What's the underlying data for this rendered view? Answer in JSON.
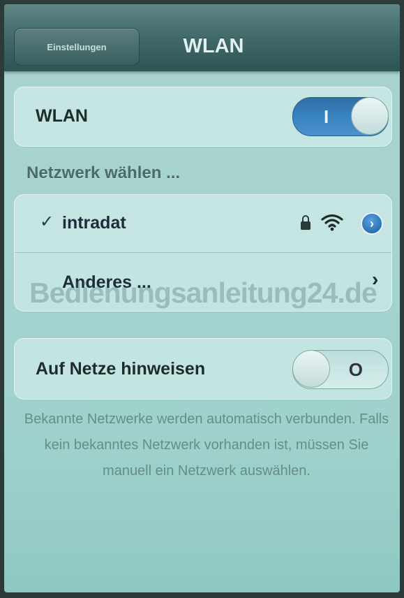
{
  "navbar": {
    "back_label": "Einstellungen",
    "title": "WLAN"
  },
  "wlan_group": {
    "label": "WLAN",
    "toggle_state": "on",
    "toggle_text": "I"
  },
  "networks": {
    "section_header": "Netzwerk wählen ...",
    "items": [
      {
        "check": "✓",
        "name": "intradat",
        "lock_icon": "lock-icon",
        "wifi_icon": "wifi-signal-icon",
        "detail_icon": "info-arrow-icon",
        "detail_glyph": "›"
      }
    ],
    "other": {
      "label": "Anderes ...",
      "chevron": "›"
    }
  },
  "ask_group": {
    "label": "Auf Netze hinweisen",
    "toggle_state": "off",
    "toggle_text": "O"
  },
  "footer": {
    "text": "Bekannte Netzwerke werden automatisch verbunden. Falls kein bekanntes Netzwerk vorhanden ist, müssen Sie manuell ein Netzwerk auswählen."
  },
  "watermark": "Bedienungsanleitung24.de",
  "colors": {
    "background": "#a6d3cf",
    "navbar": "#3f6767",
    "toggle_on": "#3b86c4",
    "info_button": "#2b6fb3"
  }
}
